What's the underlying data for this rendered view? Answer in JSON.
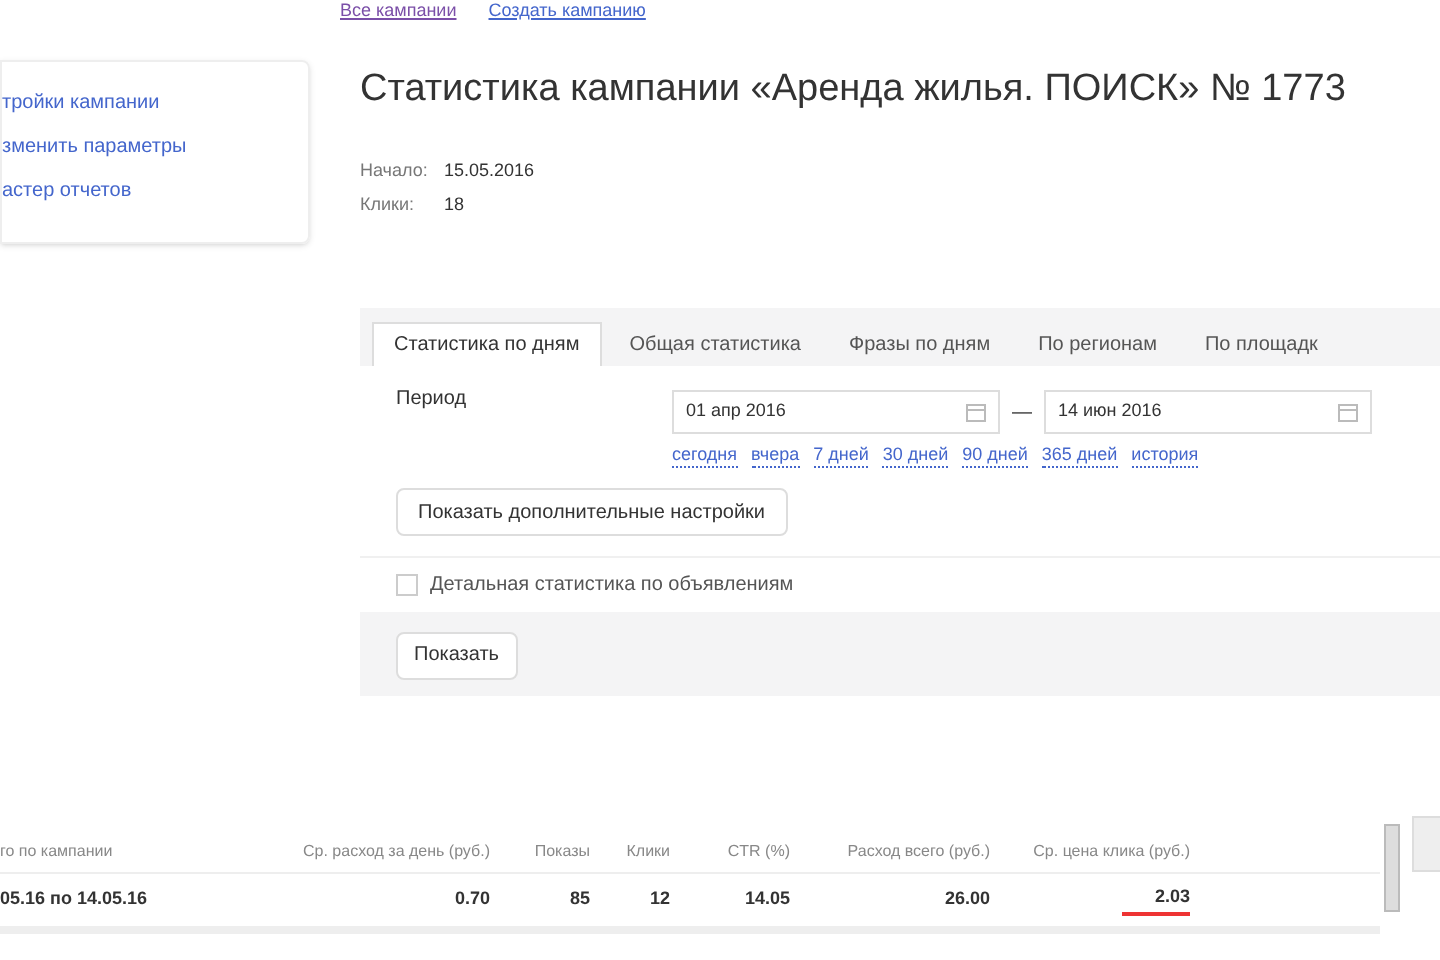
{
  "top_links": [
    {
      "label": "Все кампании",
      "visited": true
    },
    {
      "label": "Создать кампанию",
      "visited": false
    }
  ],
  "sidebar": {
    "items": [
      "тройки кампании",
      "зменить параметры",
      "астер отчетов"
    ]
  },
  "title": "Статистика кампании «Аренда жилья. ПОИСК» № 1773",
  "meta": [
    {
      "label": "Начало:",
      "value": "15.05.2016"
    },
    {
      "label": "Клики:",
      "value": "18"
    }
  ],
  "tabs": [
    {
      "label": "Статистика по дням",
      "selected": true
    },
    {
      "label": "Общая статистика",
      "selected": false
    },
    {
      "label": "Фразы по дням",
      "selected": false
    },
    {
      "label": "По регионам",
      "selected": false
    },
    {
      "label": "По площадк",
      "selected": false
    }
  ],
  "period": {
    "label": "Период",
    "from": "01 апр 2016",
    "to": "14 июн 2016",
    "dash": "—",
    "presets": [
      "сегодня",
      "вчера",
      "7 дней",
      "30 дней",
      "90 дней",
      "365 дней",
      "история"
    ]
  },
  "extra_button": "Показать дополнительные настройки",
  "detail_checkbox": {
    "label": "Детальная статистика по объявлениям",
    "checked": false
  },
  "show_button": "Показать",
  "table": {
    "columns": [
      "го по кампании",
      "Ср. расход за день (руб.)",
      "Показы",
      "Клики",
      "CTR (%)",
      "Расход всего (руб.)",
      "Ср. цена клика (руб.)"
    ],
    "rows": [
      {
        "cells": [
          {
            "text": "05.16 по 14.05.16",
            "underlined": false
          },
          {
            "text": "0.70",
            "underlined": false
          },
          {
            "text": "85",
            "underlined": false
          },
          {
            "text": "12",
            "underlined": false
          },
          {
            "text": "14.05",
            "underlined": false
          },
          {
            "text": "26.00",
            "underlined": false
          },
          {
            "text": "2.03",
            "underlined": true
          }
        ]
      }
    ]
  }
}
